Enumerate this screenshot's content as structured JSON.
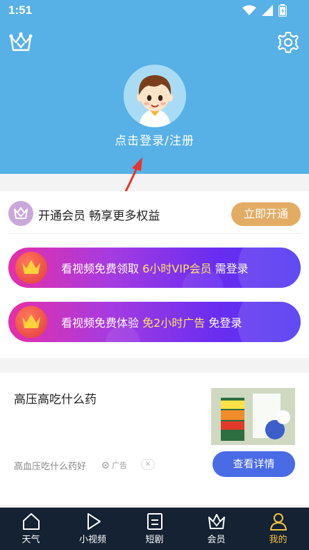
{
  "status_bar": {
    "time": "1:51"
  },
  "header": {
    "login_label": "点击登录/注册",
    "background_color": "#57b0e6"
  },
  "vip": {
    "promo_text": "开通会员 畅享更多权益",
    "open_button": "立即开通",
    "button_color": "#e3ac64"
  },
  "banners": [
    {
      "prefix": "看视频免费领取 ",
      "highlight": "6小时VIP会员",
      "suffix": " 需登录"
    },
    {
      "prefix": "看视频免费体验 ",
      "highlight": "免2小时广告",
      "suffix": " 免登录"
    }
  ],
  "ad": {
    "title": "高压高吃什么药",
    "subtitle": "高血压吃什么药好",
    "tag": "广告",
    "close": "×",
    "detail_button": "查看详情"
  },
  "tabs": [
    {
      "label": "天气",
      "icon": "home-icon",
      "active": false
    },
    {
      "label": "小视频",
      "icon": "play-icon",
      "active": false
    },
    {
      "label": "短剧",
      "icon": "drama-icon",
      "active": false
    },
    {
      "label": "会员",
      "icon": "crown-icon",
      "active": false
    },
    {
      "label": "我的",
      "icon": "profile-icon",
      "active": true
    }
  ],
  "colors": {
    "tabbar_bg": "#142233",
    "active_tab": "#f5c242",
    "accent_button": "#4a6be6"
  }
}
